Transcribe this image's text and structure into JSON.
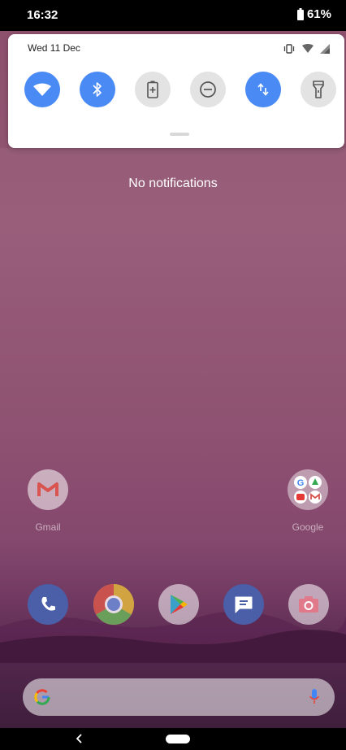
{
  "status_bar": {
    "time": "16:32",
    "battery": "61%"
  },
  "quick_settings": {
    "date": "Wed 11 Dec",
    "tiles": [
      {
        "name": "wifi",
        "state": "on"
      },
      {
        "name": "bluetooth",
        "state": "on"
      },
      {
        "name": "battery-saver",
        "state": "off"
      },
      {
        "name": "do-not-disturb",
        "state": "off"
      },
      {
        "name": "mobile-data",
        "state": "on"
      },
      {
        "name": "flashlight",
        "state": "off"
      }
    ]
  },
  "notifications": {
    "empty_text": "No notifications"
  },
  "home": {
    "apps": [
      {
        "label": "Gmail"
      },
      {
        "label": "Google"
      }
    ],
    "dock": [
      "phone",
      "chrome",
      "play-store",
      "messages",
      "camera"
    ]
  },
  "colors": {
    "accent": "#4a8af4",
    "tile_off": "#e3e3e3"
  }
}
